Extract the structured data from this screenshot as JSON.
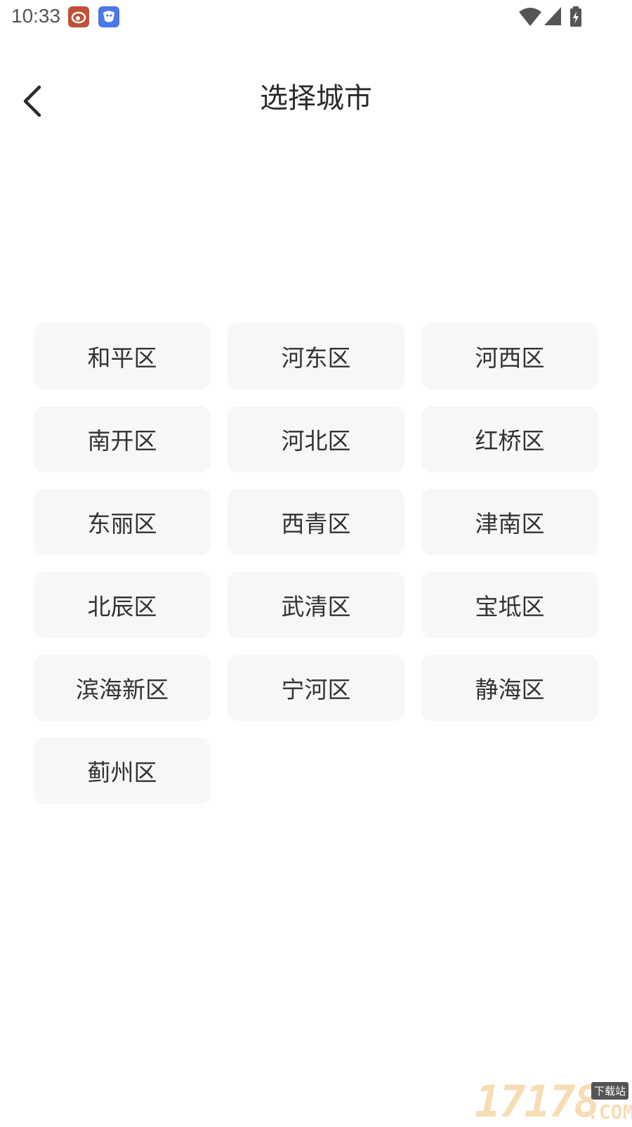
{
  "status_bar": {
    "time": "10:33",
    "notification_icons": [
      "weibo-icon",
      "bird-app-icon"
    ],
    "indicators": [
      "wifi-icon",
      "cellular-signal-icon",
      "battery-charging-icon"
    ]
  },
  "header": {
    "back_icon": "chevron-left-icon",
    "title": "选择城市"
  },
  "districts": [
    "和平区",
    "河东区",
    "河西区",
    "南开区",
    "河北区",
    "红桥区",
    "东丽区",
    "西青区",
    "津南区",
    "北辰区",
    "武清区",
    "宝坻区",
    "滨海新区",
    "宁河区",
    "静海区",
    "蓟州区"
  ],
  "watermark": {
    "digits": "17178",
    "tag": "下载站",
    "suffix": ".COM"
  },
  "colors": {
    "background": "#ffffff",
    "cell_background": "#f7f7f7",
    "text": "#333333"
  }
}
